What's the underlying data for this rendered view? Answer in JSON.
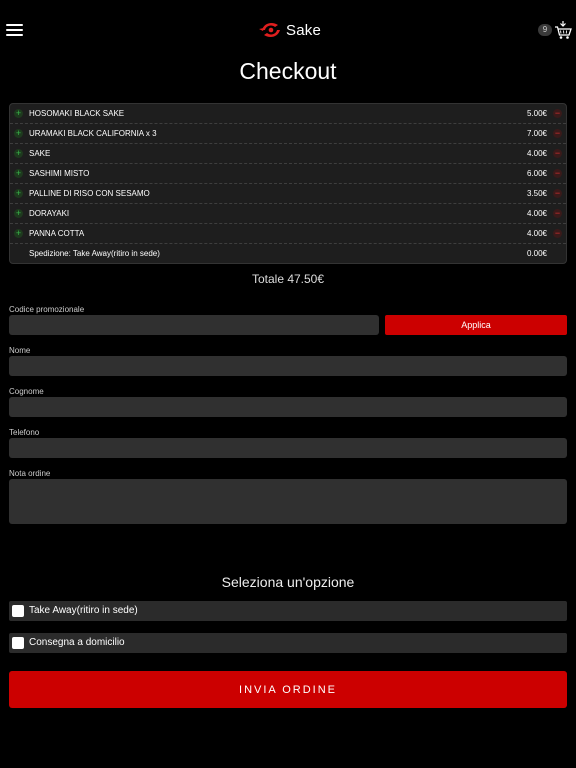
{
  "header": {
    "logo_text": "Sake",
    "cart_count": "9"
  },
  "page_title": "Checkout",
  "items": [
    {
      "name": "HOSOMAKI BLACK SAKE",
      "price": "5.00€"
    },
    {
      "name": "URAMAKI BLACK CALIFORNIA x 3",
      "price": "7.00€"
    },
    {
      "name": "SAKE",
      "price": "4.00€"
    },
    {
      "name": "SASHIMI MISTO",
      "price": "6.00€"
    },
    {
      "name": "PALLINE DI RISO CON SESAMO",
      "price": "3.50€"
    },
    {
      "name": "DORAYAKI",
      "price": "4.00€"
    },
    {
      "name": "PANNA COTTA",
      "price": "4.00€"
    }
  ],
  "shipping": {
    "label": "Spedizione: Take Away(ritiro in sede)",
    "price": "0.00€"
  },
  "total": "Totale 47.50€",
  "form": {
    "promo_label": "Codice promozionale",
    "promo_value": "",
    "apply_label": "Applica",
    "nome_label": "Nome",
    "cognome_label": "Cognome",
    "telefono_label": "Telefono",
    "nota_label": "Nota ordine"
  },
  "options": {
    "title": "Seleziona un'opzione",
    "take_away": "Take Away(ritiro in sede)",
    "consegna": "Consegna a domicilio"
  },
  "submit_label": "INVIA ORDINE",
  "colors": {
    "accent": "#cc0000",
    "plus": "#39b54a",
    "minus": "#e03030"
  }
}
